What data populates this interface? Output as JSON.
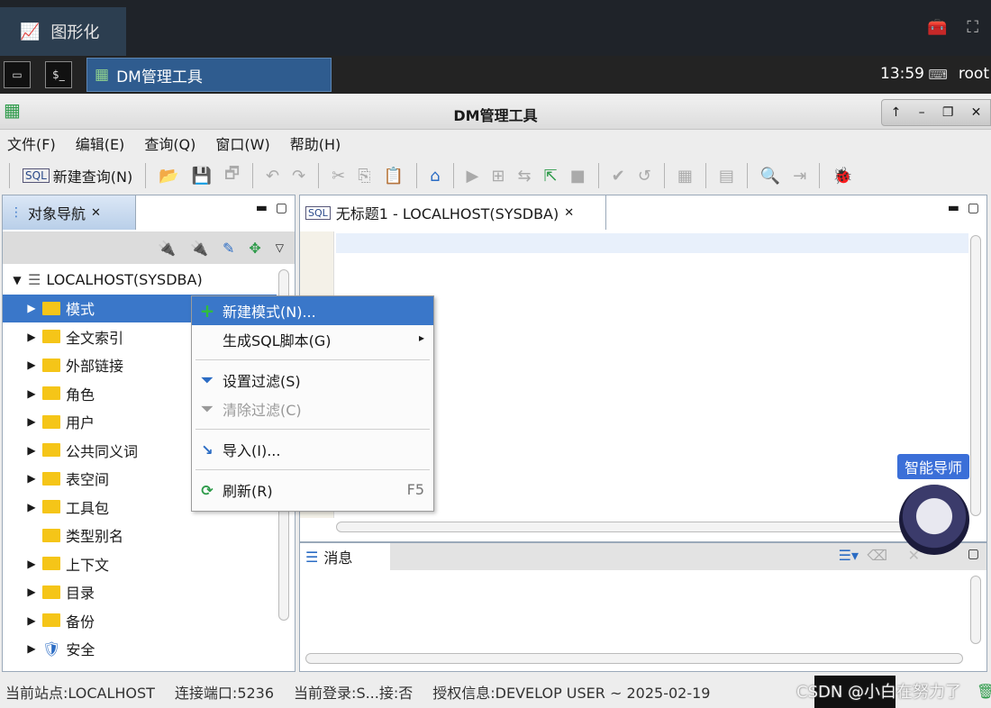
{
  "top_tab": {
    "label": "图形化"
  },
  "taskbar": {
    "app_label": "DM管理工具",
    "time": "13:59",
    "user": "root"
  },
  "window": {
    "title": "DM管理工具"
  },
  "menu": [
    "文件(F)",
    "编辑(E)",
    "查询(Q)",
    "窗口(W)",
    "帮助(H)"
  ],
  "toolbar": {
    "new_query": "新建查询(N)"
  },
  "nav": {
    "title": "对象导航",
    "root": "LOCALHOST(SYSDBA)",
    "items": [
      {
        "label": "模式",
        "arrow": "▶"
      },
      {
        "label": "全文索引",
        "arrow": "▶"
      },
      {
        "label": "外部链接",
        "arrow": "▶"
      },
      {
        "label": "角色",
        "arrow": "▶"
      },
      {
        "label": "用户",
        "arrow": "▶"
      },
      {
        "label": "公共同义词",
        "arrow": "▶"
      },
      {
        "label": "表空间",
        "arrow": "▶"
      },
      {
        "label": "工具包",
        "arrow": "▶"
      },
      {
        "label": "类型别名",
        "arrow": ""
      },
      {
        "label": "上下文",
        "arrow": "▶"
      },
      {
        "label": "目录",
        "arrow": "▶"
      },
      {
        "label": "备份",
        "arrow": "▶"
      },
      {
        "label": "安全",
        "arrow": "▶"
      }
    ]
  },
  "editor": {
    "tab_title": "无标题1 - LOCALHOST(SYSDBA)"
  },
  "messages": {
    "title": "消息"
  },
  "context_menu": {
    "new_schema": "新建模式(N)...",
    "gen_sql": "生成SQL脚本(G)",
    "set_filter": "设置过滤(S)",
    "clear_filter": "清除过滤(C)",
    "import": "导入(I)...",
    "refresh": "刷新(R)",
    "refresh_shortcut": "F5"
  },
  "assistant": {
    "label": "智能导师"
  },
  "status": {
    "site": "当前站点:LOCALHOST",
    "port": "连接端口:5236",
    "login": "当前登录:S...接:否",
    "license": "授权信息:DEVELOP USER ~ 2025-02-19"
  },
  "watermark": "CSDN @小白在努力了",
  "colors": {
    "selection": "#3a77c9",
    "accent_blue": "#2f5c8f"
  }
}
